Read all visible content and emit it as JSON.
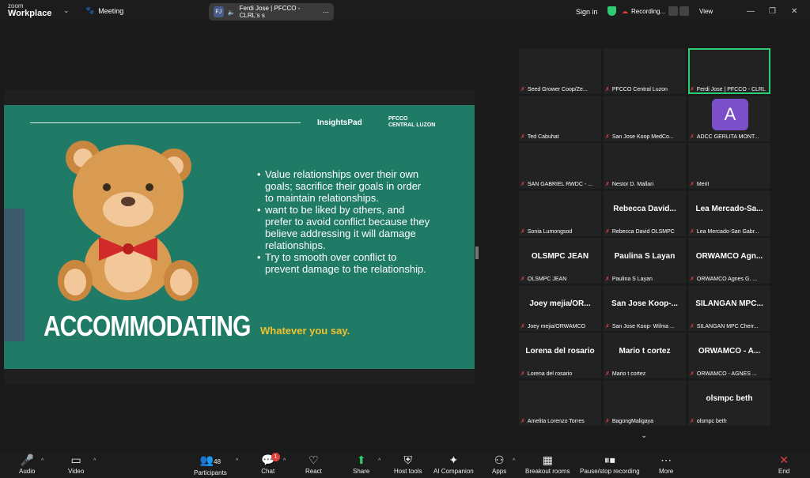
{
  "app": {
    "brand_top": "zoom",
    "brand_bottom": "Workplace",
    "meeting": "Meeting"
  },
  "speaker_pill": {
    "initials": "FJ",
    "name": "Ferdi Jose | PFCCO - CLRL's s"
  },
  "topbar": {
    "signin": "Sign in",
    "recording": "Recording...",
    "view": "View"
  },
  "slide": {
    "logo1": "InsightsPad",
    "logo2_top": "PFCCO",
    "logo2_bottom": "CENTRAL LUZON",
    "title": "ACCOMMODATING",
    "bullets": [
      "Value relationships over their own goals;  sacrifice their goals in order to maintain relationships.",
      "want to be liked by others, and prefer to avoid conflict because they believe addressing it will damage relationships.",
      "Try to smooth over conflict to prevent damage to the relationship."
    ],
    "tagline": "Whatever you say."
  },
  "participants": [
    {
      "name": "Seed Grower Coop/Ze...",
      "big": ""
    },
    {
      "name": "PFCCO Central Luzon",
      "big": ""
    },
    {
      "name": "Ferdi Jose | PFCCO - CLRL",
      "big": ""
    },
    {
      "name": "Ted Cabuhat",
      "big": ""
    },
    {
      "name": "San Jose Koop MedCo...",
      "big": ""
    },
    {
      "name": "ADCC GERLITA MONT...",
      "big": "",
      "avatar": "A"
    },
    {
      "name": "SAN GABRIEL RWDC - ...",
      "big": ""
    },
    {
      "name": "Nestor D. Mallari",
      "big": ""
    },
    {
      "name": "Merit",
      "big": ""
    },
    {
      "name": "Sonia Lumongsod",
      "big": ""
    },
    {
      "name": "Rebecca David OLSMPC",
      "big": "Rebecca  David..."
    },
    {
      "name": "Lea Mercado-San Gabr...",
      "big": "Lea Mercado-Sa..."
    },
    {
      "name": "OLSMPC JEAN",
      "big": "OLSMPC JEAN"
    },
    {
      "name": "Paulina S Layan",
      "big": "Paulina S Layan"
    },
    {
      "name": "ORWAMCO Agnes G. ...",
      "big": "ORWAMCO  Agn..."
    },
    {
      "name": "Joey mejia/ORWAMCO",
      "big": "Joey  mejia/OR..."
    },
    {
      "name": "San Jose Koop- Wilma ...",
      "big": "San Jose Koop-..."
    },
    {
      "name": "SILANGAN MPC Cherr...",
      "big": "SILANGAN  MPC..."
    },
    {
      "name": "Lorena del rosario",
      "big": "Lorena del rosario"
    },
    {
      "name": "Mario t cortez",
      "big": "Mario t cortez"
    },
    {
      "name": "ORWAMCO - AGNES ...",
      "big": "ORWAMCO  -  A..."
    },
    {
      "name": "Amelita Lorenzo Torres",
      "big": ""
    },
    {
      "name": "BagongMaligaya",
      "big": ""
    },
    {
      "name": "olsmpc beth",
      "big": "olsmpc beth"
    }
  ],
  "toolbar": {
    "audio": "Audio",
    "video": "Video",
    "participants": "Participants",
    "participants_count": "48",
    "chat": "Chat",
    "chat_badge": "1",
    "react": "React",
    "share": "Share",
    "host_tools": "Host tools",
    "ai": "AI Companion",
    "apps": "Apps",
    "breakout": "Breakout rooms",
    "pause_rec": "Pause/stop recording",
    "more": "More",
    "end": "End"
  },
  "colors": {
    "slide_bg": "#1f7a66",
    "accent": "#2ecc71",
    "end": "#e0413d",
    "tagline": "#f2c12e"
  }
}
